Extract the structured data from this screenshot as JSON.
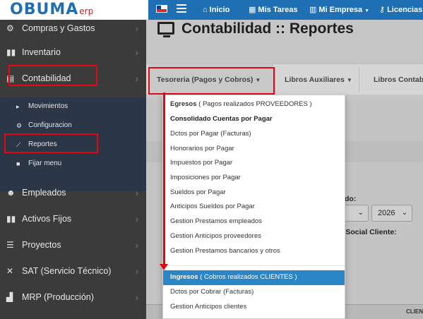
{
  "brand": {
    "logo_text": "OBUMA",
    "logo_suffix": "erp"
  },
  "topnav": {
    "items": [
      {
        "icon": "home-icon",
        "label": "Inicio"
      },
      {
        "icon": "calendar-icon",
        "label": "Mis Tareas"
      },
      {
        "icon": "building-icon",
        "label": "Mi Empresa"
      },
      {
        "icon": "key-icon",
        "label": "Licencias"
      }
    ]
  },
  "sidebar": {
    "items": [
      {
        "label": "Compras y Gastos"
      },
      {
        "label": "Inventario"
      },
      {
        "label": "Contabilidad"
      },
      {
        "label": "Empleados"
      },
      {
        "label": "Activos Fijos"
      },
      {
        "label": "Proyectos"
      },
      {
        "label": "SAT (Servicio Técnico)"
      },
      {
        "label": "MRP (Producción)"
      }
    ],
    "submenu": [
      {
        "label": "Movimientos"
      },
      {
        "label": "Configuracion"
      },
      {
        "label": "Reportes"
      },
      {
        "label": "Fijar menu"
      }
    ]
  },
  "main": {
    "title": "Contabilidad :: Reportes",
    "tabs": [
      {
        "label": "Tesoreria (Pagos y Cobros)"
      },
      {
        "label": "Libros Auxiliares"
      },
      {
        "label": "Libros Contable"
      }
    ],
    "form": {
      "label_partial_1": "do:",
      "label_partial_2": "n Social Cliente:",
      "year_value": "2026",
      "column_header": "CLIEN"
    }
  },
  "dropdown": {
    "items": [
      {
        "bold": "Egresos",
        "rest": " ( Pagos realizados PROVEEDORES )",
        "style": "normal"
      },
      {
        "bold": "Consolidado Cuentas por Pagar",
        "rest": "",
        "style": "bold"
      },
      {
        "bold": "",
        "rest": "Dctos por Pagar (Facturas)",
        "style": "normal"
      },
      {
        "bold": "",
        "rest": "Honorarios por Pagar",
        "style": "normal"
      },
      {
        "bold": "",
        "rest": "Impuestos por Pagar",
        "style": "normal"
      },
      {
        "bold": "",
        "rest": "Imposiciones por Pagar",
        "style": "normal"
      },
      {
        "bold": "",
        "rest": "Sueldos por Pagar",
        "style": "normal"
      },
      {
        "bold": "",
        "rest": "Anticipos Sueldos por Pagar",
        "style": "normal"
      },
      {
        "bold": "",
        "rest": "Gestion Prestamos empleados",
        "style": "normal"
      },
      {
        "bold": "",
        "rest": "Gestion Anticipos proveedores",
        "style": "normal"
      },
      {
        "bold": "",
        "rest": "Gestion Prestamos bancarios y otros",
        "style": "normal"
      },
      {
        "bold": "Ingresos",
        "rest": " ( Cobros realizados CLIENTES )",
        "style": "highlight"
      },
      {
        "bold": "",
        "rest": "Dctos por Cobrar (Facturas)",
        "style": "normal"
      },
      {
        "bold": "",
        "rest": "Gestion Anticipos clientes",
        "style": "normal"
      }
    ]
  },
  "colors": {
    "navbar": "#1f6fb5",
    "sidebar": "#3b3b3b",
    "submenu_panel": "#2b3646",
    "highlight": "#2a86c7",
    "annotation_red": "#e30613"
  }
}
